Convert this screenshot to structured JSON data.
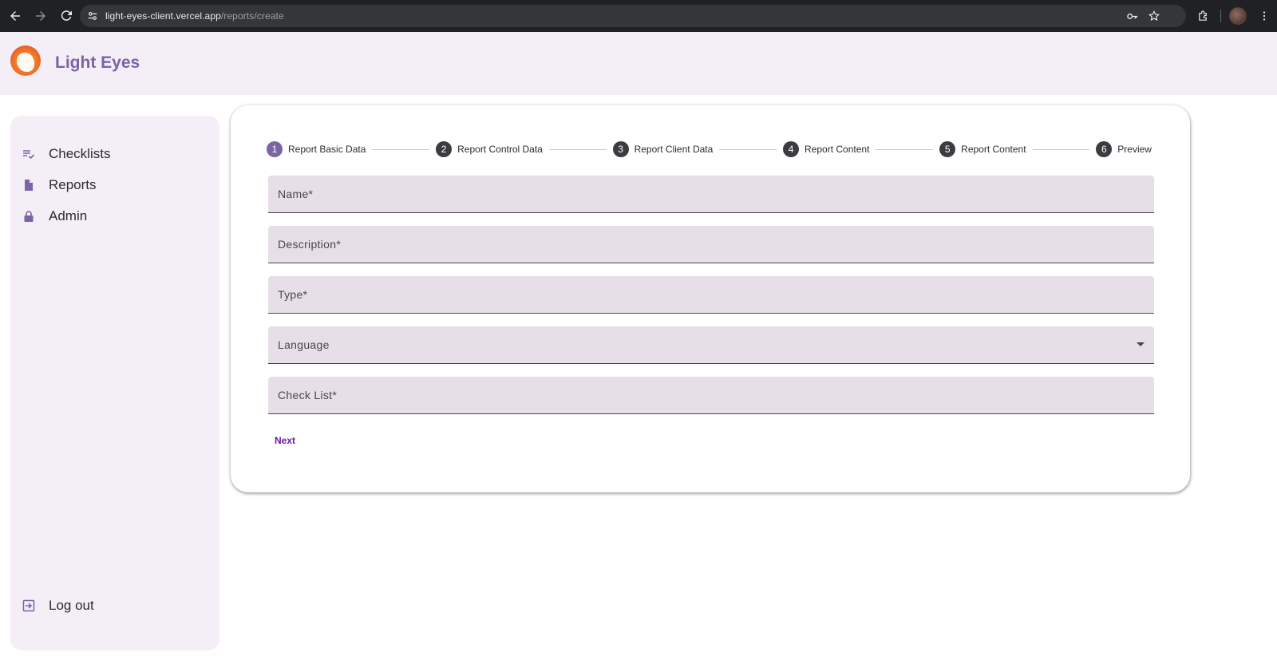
{
  "browser": {
    "url_host": "light-eyes-client.vercel.app",
    "url_path": "/reports/create"
  },
  "app": {
    "title": "Light Eyes"
  },
  "sidebar": {
    "items": [
      {
        "label": "Checklists",
        "icon": "checklist-icon"
      },
      {
        "label": "Reports",
        "icon": "document-icon"
      },
      {
        "label": "Admin",
        "icon": "lock-icon"
      }
    ],
    "logout": {
      "label": "Log out",
      "icon": "logout-icon"
    }
  },
  "stepper": {
    "steps": [
      {
        "num": "1",
        "label": "Report Basic Data"
      },
      {
        "num": "2",
        "label": "Report Control Data"
      },
      {
        "num": "3",
        "label": "Report Client Data"
      },
      {
        "num": "4",
        "label": "Report Content"
      },
      {
        "num": "5",
        "label": "Report Content"
      },
      {
        "num": "6",
        "label": "Preview"
      }
    ],
    "active_step": 1
  },
  "form": {
    "name_placeholder": "Name*",
    "description_placeholder": "Description*",
    "type_placeholder": "Type*",
    "language_label": "Language",
    "checklist_placeholder": "Check List*",
    "next_label": "Next"
  },
  "colors": {
    "accent": "#7b63a6",
    "header_bg": "#f4eef7",
    "field_bg": "#e7dfe8",
    "next_text": "#6a1b9a"
  }
}
